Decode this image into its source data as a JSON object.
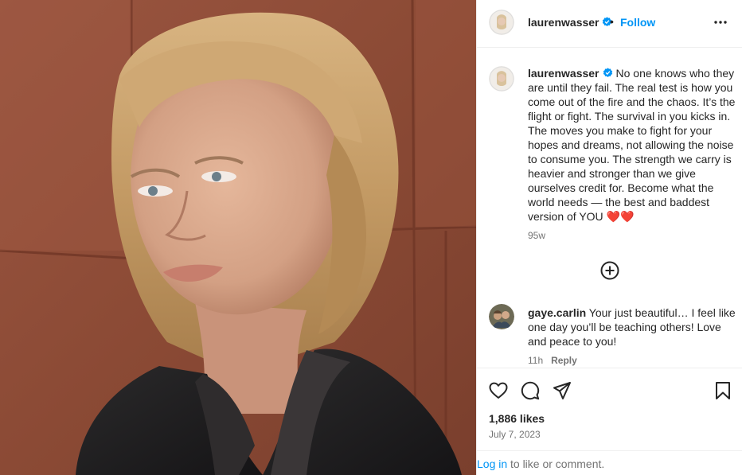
{
  "post": {
    "photo_alt": "",
    "header": {
      "username": "laurenwasser",
      "separator": "•",
      "follow_label": "Follow"
    },
    "caption": {
      "username": "laurenwasser",
      "text": "No one knows who they are until they fail. The real test is how you come out of the fire and the chaos. It’s the flight or fight. The survival in you kicks in. The moves you make to fight for your hopes and dreams, not allowing the noise to consume you. The strength we carry is heavier and stronger than we give ourselves credit for. Become what the world needs — the best and baddest version of YOU ❤️❤️",
      "time": "95w"
    },
    "comment": {
      "username": "gaye.carlin",
      "text": "Your just beautiful… I feel like one day you’ll be teaching others! Love and peace to you!",
      "time": "11h",
      "reply_label": "Reply"
    },
    "likes": "1,886 likes",
    "date": "July 7, 2023",
    "login": {
      "link": "Log in",
      "rest": "to like or comment."
    }
  },
  "colors": {
    "accent": "#0095f6",
    "text": "#262626",
    "muted": "#737373",
    "border": "#efefef"
  },
  "icons": [
    "verified-badge-icon",
    "more-options-icon",
    "load-more-comments-icon",
    "heart-icon",
    "comment-icon",
    "share-icon",
    "bookmark-icon"
  ]
}
